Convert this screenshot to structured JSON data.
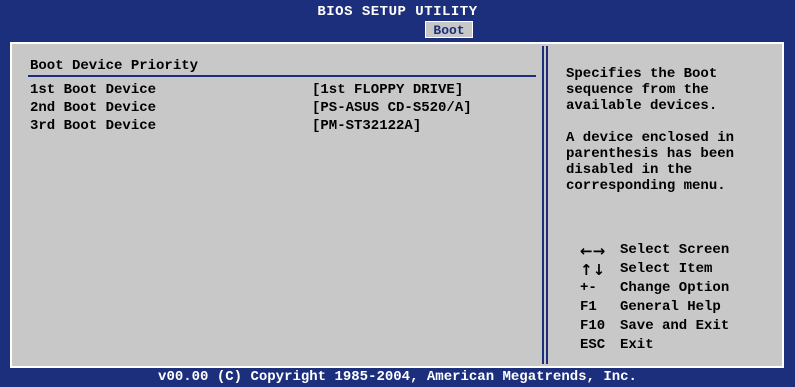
{
  "header": {
    "title": "BIOS SETUP UTILITY",
    "active_tab": "Boot"
  },
  "main": {
    "section_title": "Boot Device Priority",
    "items": [
      {
        "label": "1st Boot Device",
        "value": "[1st FLOPPY DRIVE]"
      },
      {
        "label": "2nd Boot Device",
        "value": "[PS-ASUS CD-S520/A]"
      },
      {
        "label": "3rd Boot Device",
        "value": "[PM-ST32122A]"
      }
    ]
  },
  "help": {
    "lines_p1": [
      "Specifies the Boot",
      "sequence from the",
      "available devices."
    ],
    "lines_p2": [
      "A device enclosed in",
      "parenthesis has been",
      "disabled in the",
      "corresponding menu."
    ],
    "keys": [
      {
        "key": "←→",
        "icon": "left-right-arrows-icon",
        "desc": "Select Screen"
      },
      {
        "key": "↑↓",
        "icon": "up-down-arrows-icon",
        "desc": "Select Item"
      },
      {
        "key": "+-",
        "desc": "Change Option"
      },
      {
        "key": "F1",
        "desc": "General Help"
      },
      {
        "key": "F10",
        "desc": "Save and Exit"
      },
      {
        "key": "ESC",
        "desc": "Exit"
      }
    ]
  },
  "footer": {
    "copyright": "v00.00 (C) Copyright 1985-2004, American Megatrends, Inc."
  },
  "colors": {
    "background": "#1c2f7c",
    "panel": "#c8c8c8",
    "text": "#000000",
    "header_text": "#ffffff"
  }
}
